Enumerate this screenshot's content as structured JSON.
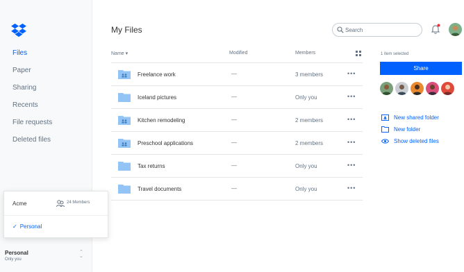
{
  "sidebar": {
    "nav": [
      "Files",
      "Paper",
      "Sharing",
      "Recents",
      "File requests",
      "Deleted files"
    ],
    "active_index": 0,
    "team_popup": {
      "team_name": "Acme",
      "members_label": "24 Members",
      "personal_label": "Personal"
    },
    "account": {
      "name": "Personal",
      "subtitle": "Only you"
    }
  },
  "header": {
    "title": "My Files",
    "search_placeholder": "Search"
  },
  "table": {
    "columns": {
      "name": "Name",
      "modified": "Modified",
      "members": "Members"
    },
    "rows": [
      {
        "name": "Freelance work",
        "modified": "—",
        "members": "3 members",
        "shared": true
      },
      {
        "name": "Iceland pictures",
        "modified": "—",
        "members": "Only you",
        "shared": false
      },
      {
        "name": "Kitchen remodeling",
        "modified": "—",
        "members": "2 members",
        "shared": true
      },
      {
        "name": "Preschool applications",
        "modified": "—",
        "members": "2 members",
        "shared": true
      },
      {
        "name": "Tax returns",
        "modified": "—",
        "members": "Only you",
        "shared": false
      },
      {
        "name": "Travel documents",
        "modified": "—",
        "members": "Only you",
        "shared": false
      }
    ],
    "more_label": "•••"
  },
  "right_panel": {
    "selected_label": "1 item selected",
    "share_label": "Share",
    "actions": [
      "New shared folder",
      "New folder",
      "Show deleted files"
    ]
  },
  "colors": {
    "accent": "#0061fe",
    "folder": "#92c5f5",
    "folder_dark": "#6aaeee"
  }
}
